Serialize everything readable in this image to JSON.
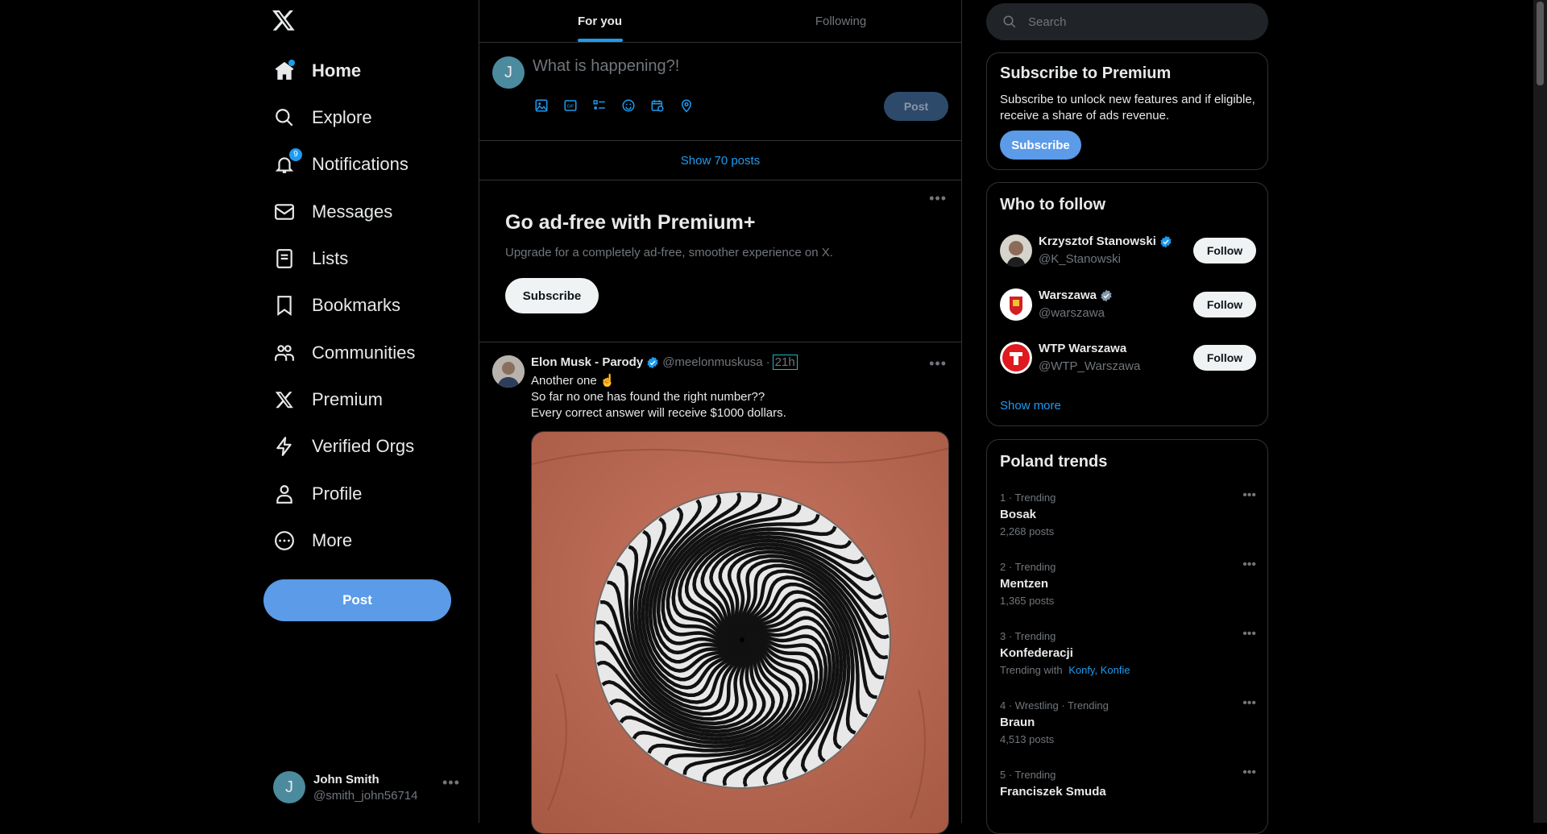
{
  "nav": {
    "items": [
      {
        "label": "Home",
        "icon": "home-icon",
        "active": true
      },
      {
        "label": "Explore",
        "icon": "search-icon"
      },
      {
        "label": "Notifications",
        "icon": "bell-icon",
        "badge": "9"
      },
      {
        "label": "Messages",
        "icon": "envelope-icon"
      },
      {
        "label": "Lists",
        "icon": "list-icon"
      },
      {
        "label": "Bookmarks",
        "icon": "bookmark-icon"
      },
      {
        "label": "Communities",
        "icon": "people-icon"
      },
      {
        "label": "Premium",
        "icon": "x-logo-icon"
      },
      {
        "label": "Verified Orgs",
        "icon": "lightning-icon"
      },
      {
        "label": "Profile",
        "icon": "person-icon"
      },
      {
        "label": "More",
        "icon": "more-circle-icon"
      }
    ],
    "post_label": "Post",
    "account": {
      "initial": "J",
      "name": "John Smith",
      "handle": "@smith_john56714"
    }
  },
  "center": {
    "tabs": [
      {
        "label": "For you",
        "active": true
      },
      {
        "label": "Following"
      }
    ],
    "composer": {
      "initial": "J",
      "placeholder": "What is happening?!",
      "post_label": "Post"
    },
    "show_posts": "Show 70 posts",
    "premium_card": {
      "title": "Go ad-free with Premium+",
      "text": "Upgrade for a completely ad-free, smoother experience on X.",
      "button": "Subscribe"
    },
    "tweet": {
      "name": "Elon Musk - Parody",
      "handle": "@meelonmuskusa",
      "sep": "·",
      "time": "21h",
      "lines": [
        "Another one ☝",
        "So far no one has found the right number??",
        "Every correct answer will receive $1000 dollars."
      ]
    }
  },
  "right": {
    "search_placeholder": "Search",
    "premium": {
      "title": "Subscribe to Premium",
      "text": "Subscribe to unlock new features and if eligible, receive a share of ads revenue.",
      "button": "Subscribe"
    },
    "who_to_follow": {
      "title": "Who to follow",
      "users": [
        {
          "name": "Krzysztof Stanowski",
          "handle": "@K_Stanowski",
          "button": "Follow",
          "badge_color": "#1d9bf0"
        },
        {
          "name": "Warszawa",
          "handle": "@warszawa",
          "button": "Follow",
          "badge_color": "#829aab"
        },
        {
          "name": "WTP Warszawa",
          "handle": "@WTP_Warszawa",
          "button": "Follow"
        }
      ],
      "show_more": "Show more"
    },
    "trends": {
      "title": "Poland trends",
      "items": [
        {
          "meta": "1 · Trending",
          "title": "Bosak",
          "count": "2,268 posts"
        },
        {
          "meta": "2 · Trending",
          "title": "Mentzen",
          "count": "1,365 posts"
        },
        {
          "meta": "3 · Trending",
          "title": "Konfederacji",
          "with_label": "Trending with",
          "with_links": [
            "Konfy",
            "Konfie"
          ]
        },
        {
          "meta": "4 · Wrestling · Trending",
          "title": "Braun",
          "count": "4,513 posts"
        },
        {
          "meta": "5 · Trending",
          "title": "Franciszek Smuda"
        }
      ]
    }
  },
  "colors": {
    "accent": "#1d9bf0",
    "post_button": "#5b9be8",
    "background": "#000000"
  }
}
